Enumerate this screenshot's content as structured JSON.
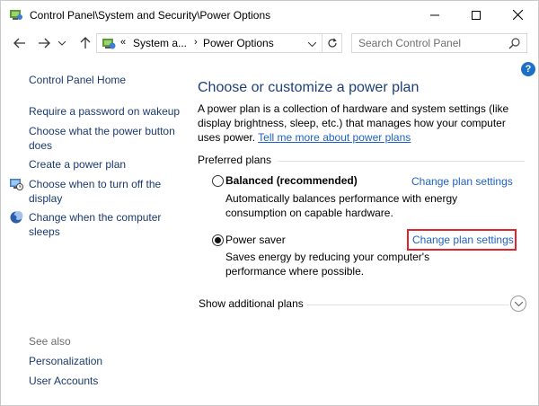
{
  "window": {
    "title": "Control Panel\\System and Security\\Power Options"
  },
  "address": {
    "overflow": "«",
    "segment1": "System a...",
    "separator": "›",
    "segment2": "Power Options"
  },
  "search": {
    "placeholder": "Search Control Panel",
    "value": ""
  },
  "help": {
    "label": "?"
  },
  "sidebar": {
    "home": "Control Panel Home",
    "links": [
      "Require a password on wakeup",
      "Choose what the power button does",
      "Create a power plan",
      "Choose when to turn off the display",
      "Change when the computer sleeps"
    ],
    "see_also_heading": "See also",
    "see_also": [
      "Personalization",
      "User Accounts"
    ]
  },
  "main": {
    "title": "Choose or customize a power plan",
    "description": "A power plan is a collection of hardware and system settings (like display brightness, sleep, etc.) that manages how your computer uses power.",
    "learn_more": "Tell me more about power plans",
    "preferred_label": "Preferred plans",
    "plans": [
      {
        "name": "Balanced (recommended)",
        "selected": false,
        "description": "Automatically balances performance with energy consumption on capable hardware.",
        "change_label": "Change plan settings"
      },
      {
        "name": "Power saver",
        "selected": true,
        "description": "Saves energy by reducing your computer's performance where possible.",
        "change_label": "Change plan settings"
      }
    ],
    "show_additional": "Show additional plans"
  },
  "colors": {
    "link": "#1e62c3",
    "title": "#1e3f7a",
    "highlight": "#e0252d"
  }
}
